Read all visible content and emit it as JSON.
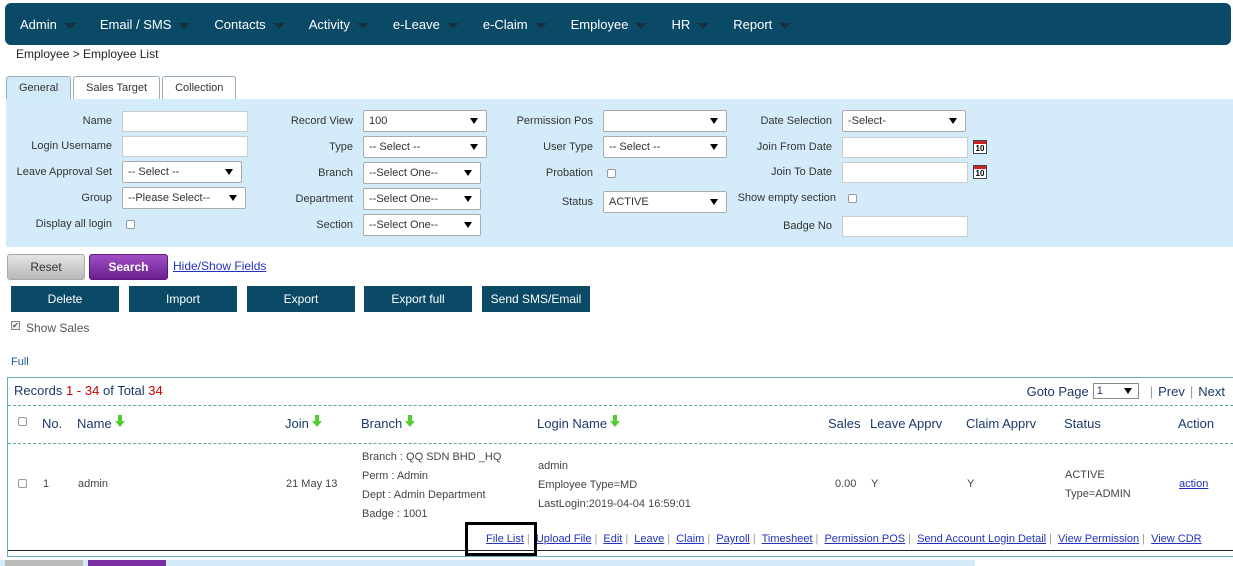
{
  "nav": {
    "items": [
      "Admin",
      "Email / SMS",
      "Contacts",
      "Activity",
      "e-Leave",
      "e-Claim",
      "Employee",
      "HR",
      "Report"
    ]
  },
  "breadcrumb": "Employee > Employee List",
  "tabs": [
    "General",
    "Sales Target",
    "Collection"
  ],
  "filters": {
    "name": "Name",
    "login_username": "Login Username",
    "leave_approval_set": "Leave Approval Set",
    "leave_approval_value": "-- Select --",
    "group": "Group",
    "group_value": "--Please Select--",
    "display_all_login": "Display all login",
    "record_view": "Record View",
    "record_view_value": "100",
    "type": "Type",
    "type_value": "-- Select --",
    "branch": "Branch",
    "branch_value": "--Select One--",
    "department": "Department",
    "department_value": "--Select One--",
    "section": "Section",
    "section_value": "--Select One--",
    "permission_pos": "Permission Pos",
    "permission_pos_value": "",
    "user_type": "User Type",
    "user_type_value": "-- Select --",
    "probation": "Probation",
    "status": "Status",
    "status_value": "ACTIVE",
    "date_selection": "Date Selection",
    "date_selection_value": "-Select-",
    "join_from_date": "Join From Date",
    "join_to_date": "Join To Date",
    "show_empty_section": "Show empty section",
    "badge_no": "Badge No",
    "calendar_day": "10"
  },
  "buttons": {
    "reset": "Reset",
    "search": "Search",
    "hide_show": "Hide/Show Fields",
    "delete": "Delete",
    "import": "Import",
    "export": "Export",
    "export_full": "Export full",
    "send_sms": "Send SMS/Email"
  },
  "show_sales": "Show Sales",
  "full": "Full",
  "records": {
    "prefix": "Records",
    "from": "1",
    "dash": "-",
    "to": "34",
    "of_total": "of Total",
    "total": "34"
  },
  "pager": {
    "goto_page": "Goto Page",
    "page_value": "1",
    "prev": "Prev",
    "next": "Next"
  },
  "table": {
    "headers": {
      "no": "No.",
      "name": "Name",
      "join": "Join",
      "branch": "Branch",
      "login_name": "Login Name",
      "sales": "Sales",
      "leave_apprv": "Leave Apprv",
      "claim_apprv": "Claim Apprv",
      "status": "Status",
      "action": "Action"
    },
    "rows": [
      {
        "no": "1",
        "name": "admin",
        "join": "21 May 13",
        "branch_lines": [
          "Branch : QQ SDN BHD _HQ",
          "Perm : Admin",
          "Dept : Admin Department",
          "Badge : 1001"
        ],
        "login_lines": [
          "admin",
          "Employee Type=MD",
          "LastLogin:2019-04-04 16:59:01"
        ],
        "sales": "0.00",
        "leave_apprv": "Y",
        "claim_apprv": "Y",
        "status_lines": [
          "ACTIVE",
          "Type=ADMIN"
        ],
        "action": "action"
      }
    ]
  },
  "row_links": [
    "File List",
    "Upload File",
    "Edit",
    "Leave",
    "Claim",
    "Payroll",
    "Timesheet",
    "Permission POS",
    "Send Account Login Detail",
    "View Permission",
    "View CDR"
  ],
  "colors": {
    "nav_bg": "#0b4a66",
    "panel_bg": "#d4ecf9",
    "search_btn": "#7a2ea0",
    "link": "#2233bb",
    "record_count": "#cc0000"
  }
}
